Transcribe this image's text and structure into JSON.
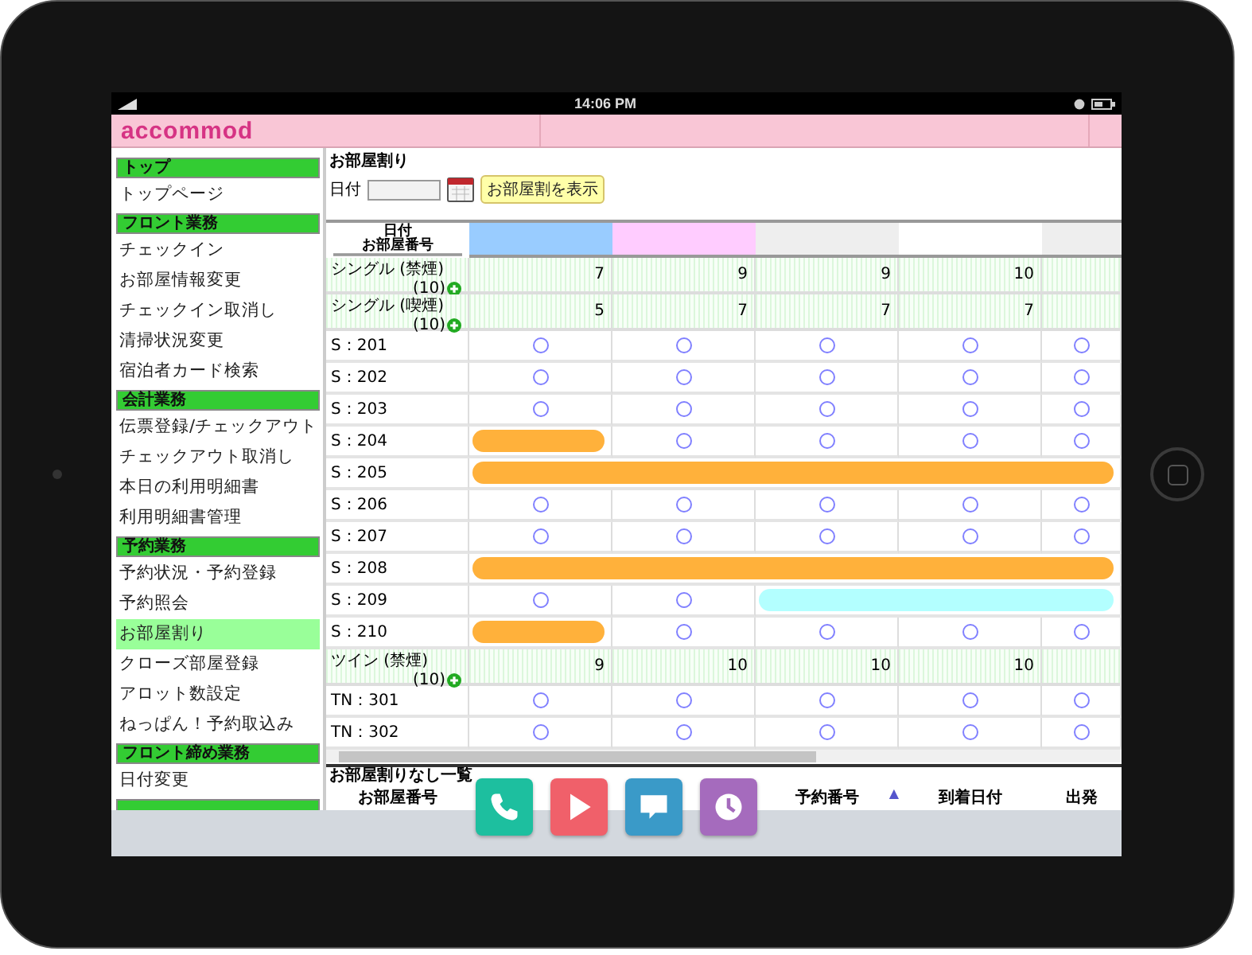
{
  "status_bar": {
    "time": "14:06 PM"
  },
  "app": {
    "logo": "accommod"
  },
  "sidebar": {
    "sections": [
      {
        "title": "トップ",
        "items": [
          {
            "label": "トップページ",
            "selected": false
          }
        ]
      },
      {
        "title": "フロント業務",
        "items": [
          {
            "label": "チェックイン",
            "selected": false
          },
          {
            "label": "お部屋情報変更",
            "selected": false
          },
          {
            "label": "チェックイン取消し",
            "selected": false
          },
          {
            "label": "清掃状況変更",
            "selected": false
          },
          {
            "label": "宿泊者カード検索",
            "selected": false
          }
        ]
      },
      {
        "title": "会計業務",
        "items": [
          {
            "label": "伝票登録/チェックアウト",
            "selected": false
          },
          {
            "label": "チェックアウト取消し",
            "selected": false
          },
          {
            "label": "本日の利用明細書",
            "selected": false
          },
          {
            "label": "利用明細書管理",
            "selected": false
          }
        ]
      },
      {
        "title": "予約業務",
        "items": [
          {
            "label": "予約状況・予約登録",
            "selected": false
          },
          {
            "label": "予約照会",
            "selected": false
          },
          {
            "label": "お部屋割り",
            "selected": true
          },
          {
            "label": "クローズ部屋登録",
            "selected": false
          },
          {
            "label": "アロット数設定",
            "selected": false
          },
          {
            "label": "ねっぱん！予約取込み",
            "selected": false
          }
        ]
      },
      {
        "title": "フロント締め業務",
        "items": [
          {
            "label": "日付変更",
            "selected": false
          }
        ]
      }
    ]
  },
  "main": {
    "title": "お部屋割り",
    "date_label": "日付",
    "show_button": "お部屋割を表示"
  },
  "grid": {
    "header_top": "日付",
    "header_bottom": "お部屋番号",
    "date_columns": [
      {
        "color": "#99ccff"
      },
      {
        "color": "#ffccff"
      },
      {
        "color": "#eeeeee"
      },
      {
        "color": "#ffffff"
      },
      {
        "color": "#eeeeee"
      }
    ],
    "rows": [
      {
        "kind": "type",
        "name": "シングル (禁煙)",
        "count": "(10)",
        "values": [
          "7",
          "9",
          "9",
          "10"
        ]
      },
      {
        "kind": "type",
        "name": "シングル (喫煙)",
        "count": "(10)",
        "values": [
          "5",
          "7",
          "7",
          "7"
        ]
      },
      {
        "kind": "room",
        "name": "S：201",
        "cells": [
          {
            "kind": "vacant"
          },
          {
            "kind": "vacant"
          },
          {
            "kind": "vacant"
          },
          {
            "kind": "vacant"
          },
          {
            "kind": "vacant"
          }
        ]
      },
      {
        "kind": "room",
        "name": "S：202",
        "cells": [
          {
            "kind": "vacant"
          },
          {
            "kind": "vacant"
          },
          {
            "kind": "vacant"
          },
          {
            "kind": "vacant"
          },
          {
            "kind": "vacant"
          }
        ]
      },
      {
        "kind": "room",
        "name": "S：203",
        "cells": [
          {
            "kind": "vacant"
          },
          {
            "kind": "vacant"
          },
          {
            "kind": "vacant"
          },
          {
            "kind": "vacant"
          },
          {
            "kind": "vacant"
          }
        ]
      },
      {
        "kind": "room",
        "name": "S：204",
        "cells": [
          {
            "kind": "booked",
            "color": "#ffb13b"
          },
          {
            "kind": "vacant"
          },
          {
            "kind": "vacant"
          },
          {
            "kind": "vacant"
          },
          {
            "kind": "vacant"
          }
        ]
      },
      {
        "kind": "room",
        "name": "S：205",
        "cells": [
          {
            "kind": "booked",
            "color": "#ffb13b"
          },
          {
            "kind": "booked",
            "color": "#ffb13b"
          },
          {
            "kind": "booked",
            "color": "#ffb13b"
          },
          {
            "kind": "booked",
            "color": "#ffb13b"
          },
          {
            "kind": "booked",
            "color": "#ffb13b"
          }
        ]
      },
      {
        "kind": "room",
        "name": "S：206",
        "cells": [
          {
            "kind": "vacant"
          },
          {
            "kind": "vacant"
          },
          {
            "kind": "vacant"
          },
          {
            "kind": "vacant"
          },
          {
            "kind": "vacant"
          }
        ]
      },
      {
        "kind": "room",
        "name": "S：207",
        "cells": [
          {
            "kind": "vacant"
          },
          {
            "kind": "vacant"
          },
          {
            "kind": "vacant"
          },
          {
            "kind": "vacant"
          },
          {
            "kind": "vacant"
          }
        ]
      },
      {
        "kind": "room",
        "name": "S：208",
        "cells": [
          {
            "kind": "booked",
            "color": "#ffb13b"
          },
          {
            "kind": "booked",
            "color": "#ffb13b"
          },
          {
            "kind": "booked",
            "color": "#ffb13b"
          },
          {
            "kind": "booked",
            "color": "#ffb13b"
          },
          {
            "kind": "booked",
            "color": "#ffb13b"
          }
        ]
      },
      {
        "kind": "room",
        "name": "S：209",
        "cells": [
          {
            "kind": "vacant"
          },
          {
            "kind": "vacant"
          },
          {
            "kind": "booked",
            "color": "#b3ffff"
          },
          {
            "kind": "booked",
            "color": "#b3ffff"
          },
          {
            "kind": "booked",
            "color": "#b3ffff"
          }
        ]
      },
      {
        "kind": "room",
        "name": "S：210",
        "cells": [
          {
            "kind": "booked",
            "color": "#ffb13b"
          },
          {
            "kind": "vacant"
          },
          {
            "kind": "vacant"
          },
          {
            "kind": "vacant"
          },
          {
            "kind": "vacant"
          }
        ]
      },
      {
        "kind": "type",
        "name": "ツイン (禁煙)",
        "count": "(10)",
        "values": [
          "9",
          "10",
          "10",
          "10"
        ]
      },
      {
        "kind": "room",
        "name": "TN：301",
        "cells": [
          {
            "kind": "vacant"
          },
          {
            "kind": "vacant"
          },
          {
            "kind": "vacant"
          },
          {
            "kind": "vacant"
          },
          {
            "kind": "vacant"
          }
        ]
      },
      {
        "kind": "room",
        "name": "TN：302",
        "cells": [
          {
            "kind": "vacant"
          },
          {
            "kind": "vacant"
          },
          {
            "kind": "vacant"
          },
          {
            "kind": "vacant"
          },
          {
            "kind": "vacant"
          }
        ]
      }
    ]
  },
  "unassigned": {
    "title": "お部屋割りなし一覧",
    "columns": [
      {
        "label": "お部屋番号"
      },
      {
        "label": "予約番号",
        "sort": "▲"
      },
      {
        "label": "到着日付"
      },
      {
        "label": "出発"
      }
    ]
  },
  "dock": [
    {
      "kind": "phone",
      "color": "#1dbf9f"
    },
    {
      "kind": "play",
      "color": "#f0606a"
    },
    {
      "kind": "chat",
      "color": "#3a9ac8"
    },
    {
      "kind": "clock",
      "color": "#a56bbd"
    }
  ]
}
